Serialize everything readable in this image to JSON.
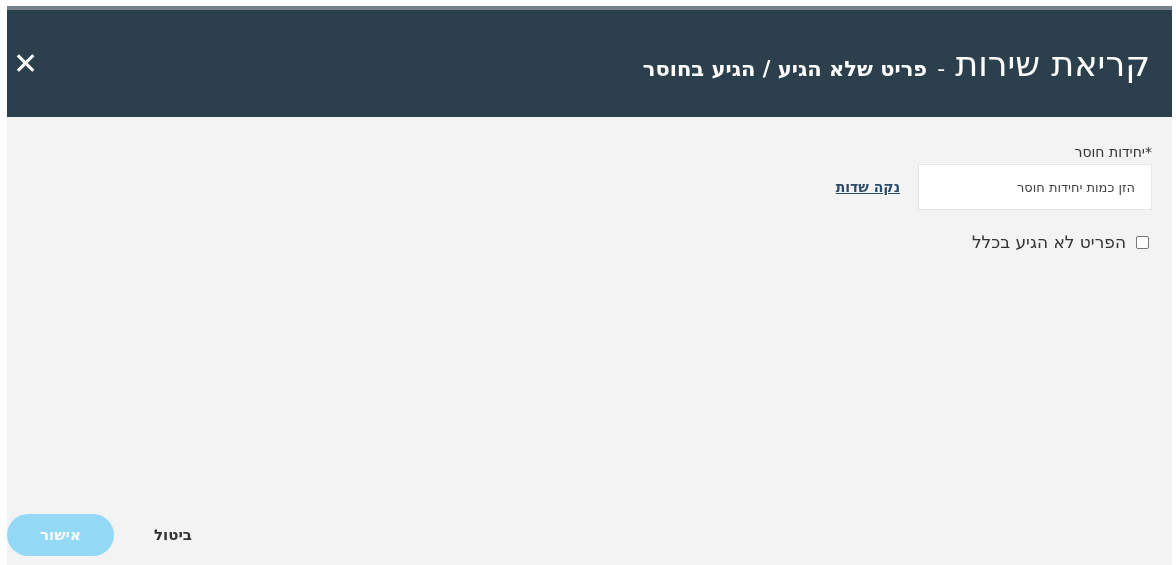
{
  "header": {
    "title": "קריאת שירות",
    "separator": "-",
    "subtitle": "פריט שלא הגיע / הגיע בחוסר",
    "close": "✕"
  },
  "form": {
    "field": {
      "label": "*יחידות חוסר",
      "placeholder": "הזן כמות יחידות חוסר"
    },
    "clear_link": "נקה שדות",
    "checkbox": {
      "label": "הפריט לא הגיע בכלל",
      "checked": false
    }
  },
  "footer": {
    "buttons": [
      {
        "kind": "text",
        "label": "ביטול",
        "disabled": false
      },
      {
        "kind": "primary",
        "label": "אישור",
        "disabled": true
      }
    ]
  }
}
